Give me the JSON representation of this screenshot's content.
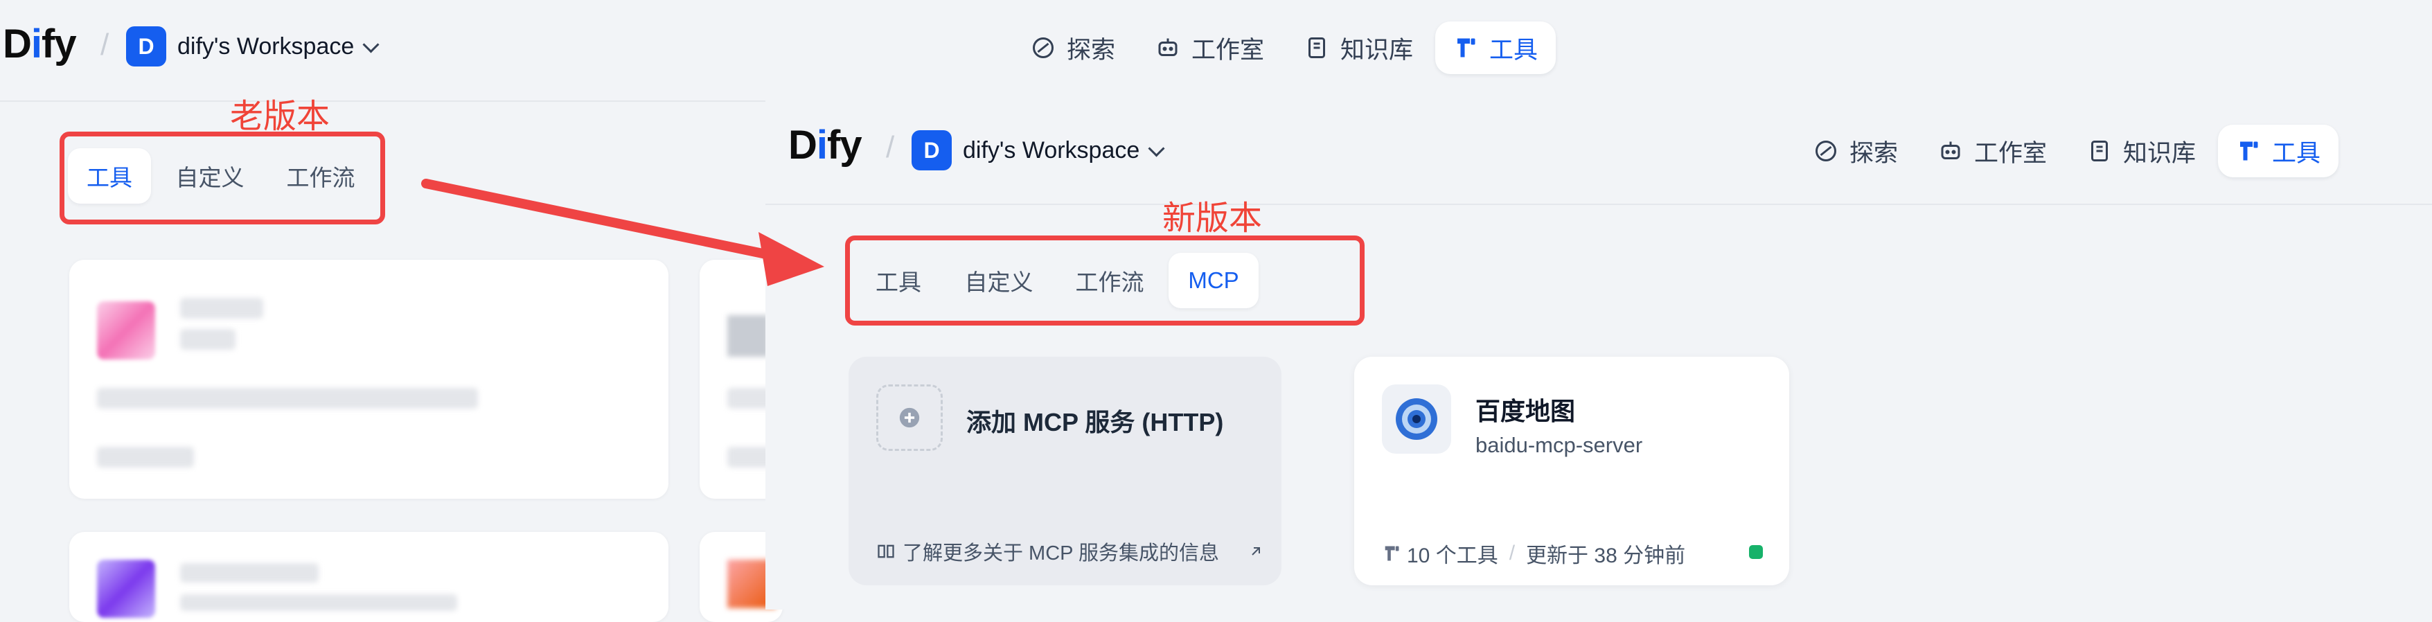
{
  "old": {
    "logo": {
      "pre": "D",
      "i": "i",
      "post": "fy"
    },
    "workspace": {
      "badge": "D",
      "name": "dify's Workspace"
    },
    "nav": [
      {
        "label": "探索",
        "icon": "explore-icon"
      },
      {
        "label": "工作室",
        "icon": "robot-icon"
      },
      {
        "label": "知识库",
        "icon": "book-icon"
      },
      {
        "label": "工具",
        "icon": "tools-icon",
        "active": true
      }
    ],
    "annotation": "老版本",
    "tabs": [
      {
        "label": "工具",
        "active": true
      },
      {
        "label": "自定义"
      },
      {
        "label": "工作流"
      }
    ]
  },
  "new": {
    "logo": {
      "pre": "D",
      "i": "i",
      "post": "fy"
    },
    "workspace": {
      "badge": "D",
      "name": "dify's Workspace"
    },
    "nav": [
      {
        "label": "探索",
        "icon": "explore-icon"
      },
      {
        "label": "工作室",
        "icon": "robot-icon"
      },
      {
        "label": "知识库",
        "icon": "book-icon"
      },
      {
        "label": "工具",
        "icon": "tools-icon",
        "active": true
      }
    ],
    "annotation": "新版本",
    "tabs": [
      {
        "label": "工具"
      },
      {
        "label": "自定义"
      },
      {
        "label": "工作流"
      },
      {
        "label": "MCP",
        "active": true
      }
    ],
    "add_card": {
      "title": "添加 MCP 服务 (HTTP)",
      "link": "了解更多关于 MCP 服务集成的信息"
    },
    "server_card": {
      "name": "百度地图",
      "id": "baidu-mcp-server",
      "tools": "10 个工具",
      "separator": "/",
      "updated": "更新于 38 分钟前",
      "status_color": "#17b26a"
    }
  },
  "colors": {
    "accent": "#155eef",
    "annotation": "#ef4444",
    "background": "#f2f4f7"
  }
}
